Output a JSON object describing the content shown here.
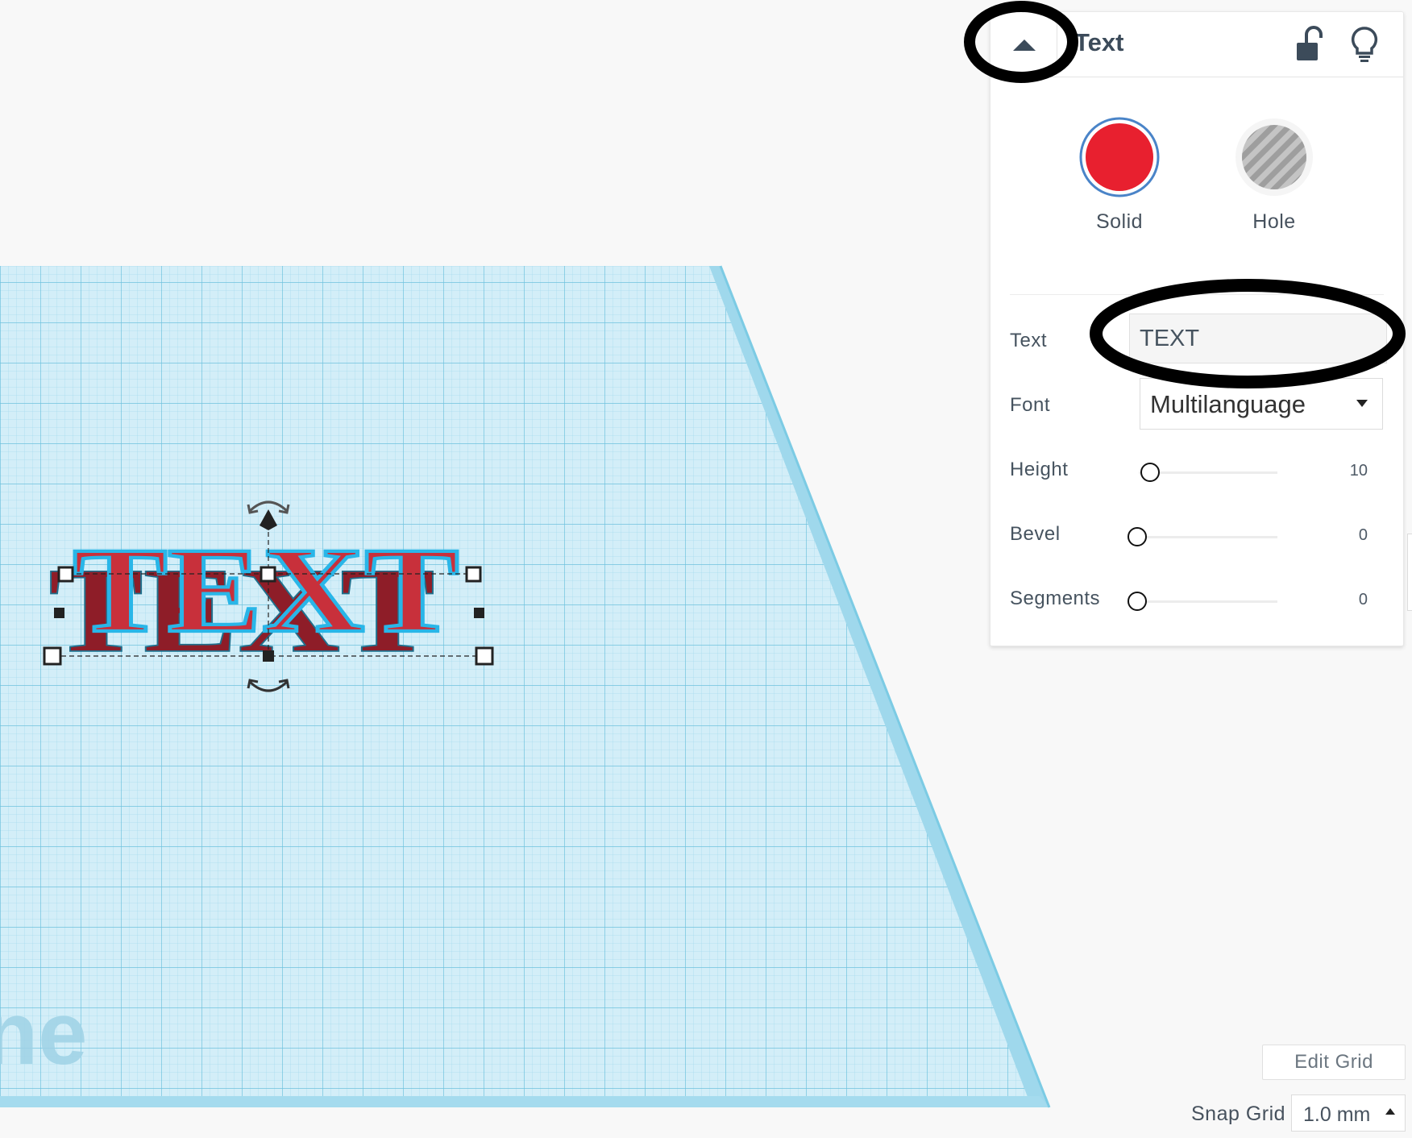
{
  "panel": {
    "title": "Text",
    "shape_types": [
      {
        "label": "Solid",
        "selected": true,
        "color": "#e8202f"
      },
      {
        "label": "Hole",
        "selected": false
      }
    ],
    "properties": {
      "text": {
        "label": "Text",
        "value": "TEXT"
      },
      "font": {
        "label": "Font",
        "value": "Multilanguage"
      },
      "height": {
        "label": "Height",
        "value": "10",
        "level": 0
      },
      "bevel": {
        "label": "Bevel",
        "value": "0",
        "level": 0
      },
      "segments": {
        "label": "Segments",
        "value": "0",
        "level": 0
      }
    }
  },
  "workplane": {
    "shape_text": "TEXT",
    "watermark": "ne",
    "grid_color": "#d3eef8",
    "shape_color": "#c8303b",
    "selection_color": "#29b6e8"
  },
  "grid_controls": {
    "edit_grid_label": "Edit Grid",
    "snap_label": "Snap Grid",
    "snap_value": "1.0 mm"
  },
  "annotations": {
    "color": "#000000",
    "count": 2
  }
}
